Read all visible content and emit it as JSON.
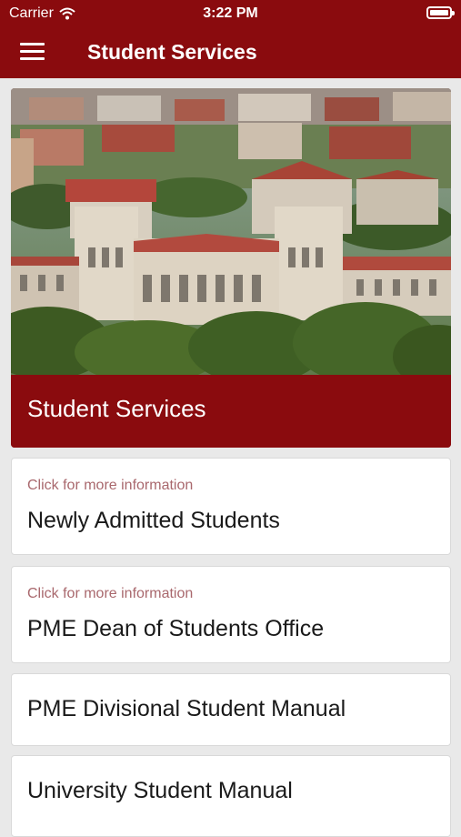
{
  "status_bar": {
    "carrier": "Carrier",
    "time": "3:22 PM"
  },
  "nav": {
    "title": "Student Services",
    "menu_icon": "hamburger-menu-icon"
  },
  "hero": {
    "caption": "Student Services",
    "image": "university-campus-aerial-photo"
  },
  "cards": [
    {
      "hint": "Click for more information",
      "title": "Newly Admitted Students"
    },
    {
      "hint": "Click for more information",
      "title": "PME Dean of Students Office"
    },
    {
      "title": "PME Divisional Student Manual"
    },
    {
      "title": "University Student Manual"
    }
  ],
  "colors": {
    "brand": "#8a0b0e",
    "hint": "#a9686d",
    "background": "#e9e9e9"
  }
}
